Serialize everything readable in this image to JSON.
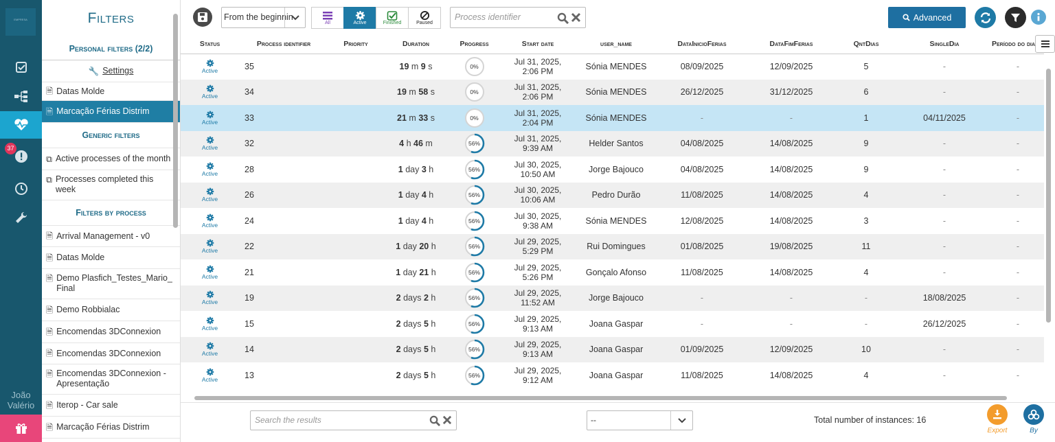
{
  "rail": {
    "logo_text": "EMPRESA",
    "badge": "37",
    "user": "João Valério"
  },
  "filters": {
    "title": "Filters",
    "personal_header": "Personal filters (2/2)",
    "settings_label": "Settings",
    "personal_items": [
      "Datas Molde",
      "Marcação Férias Distrim"
    ],
    "generic_header": "Generic filters",
    "generic_items": [
      "Active processes of the month",
      "Processes completed this week"
    ],
    "byprocess_header": "Filters by process",
    "process_items": [
      "Arrival Management - v0",
      "Datas Molde",
      "Demo Plasfich_Testes_Mario_Final",
      "Demo Robbialac",
      "Encomendas 3DConnexion",
      "Encomendas 3DConnexion",
      "Encomendas 3DConnexion - Apresentação",
      "Iterop - Car sale",
      "Marcação Férias Distrim"
    ]
  },
  "toolbar": {
    "date_filter": "From the beginnin",
    "segments": [
      {
        "label": "All",
        "icon": "list-icon"
      },
      {
        "label": "Active",
        "icon": "gear-icon"
      },
      {
        "label": "Finished",
        "icon": "check-icon"
      },
      {
        "label": "Paused",
        "icon": "ban-icon"
      }
    ],
    "process_placeholder": "Process identifier",
    "advanced_label": "Advanced"
  },
  "columns": [
    "Status",
    "Process identifier",
    "Priority",
    "Duration",
    "Progress",
    "Start date",
    "user_name",
    "DataInicioFerias",
    "DataFimFerias",
    "QntDias",
    "SingleDia",
    "Período do dia"
  ],
  "rows": [
    {
      "status": "Active",
      "id": "35",
      "priority": "",
      "dur": [
        [
          "19",
          "m"
        ],
        [
          "9",
          "s"
        ]
      ],
      "progress": 0,
      "pct": "0%",
      "start1": "Jul 31, 2025,",
      "start2": "2:06 PM",
      "user": "Sónia MENDES",
      "inicio": "08/09/2025",
      "fim": "12/09/2025",
      "qnt": "5",
      "single": "-",
      "periodo": "-"
    },
    {
      "status": "Active",
      "id": "34",
      "priority": "",
      "dur": [
        [
          "19",
          "m"
        ],
        [
          "58",
          "s"
        ]
      ],
      "progress": 0,
      "pct": "0%",
      "start1": "Jul 31, 2025,",
      "start2": "2:06 PM",
      "user": "Sónia MENDES",
      "inicio": "26/12/2025",
      "fim": "31/12/2025",
      "qnt": "6",
      "single": "-",
      "periodo": "-"
    },
    {
      "status": "Active",
      "id": "33",
      "priority": "",
      "dur": [
        [
          "21",
          "m"
        ],
        [
          "33",
          "s"
        ]
      ],
      "progress": 0,
      "pct": "0%",
      "start1": "Jul 31, 2025,",
      "start2": "2:04 PM",
      "user": "Sónia MENDES",
      "inicio": "-",
      "fim": "-",
      "qnt": "1",
      "single": "04/11/2025",
      "periodo": "-",
      "selected": true
    },
    {
      "status": "Active",
      "id": "32",
      "priority": "",
      "dur": [
        [
          "4",
          "h"
        ],
        [
          "46",
          "m"
        ]
      ],
      "progress": 0.56,
      "pct": "56%",
      "start1": "Jul 31, 2025,",
      "start2": "9:39 AM",
      "user": "Helder Santos",
      "inicio": "04/08/2025",
      "fim": "14/08/2025",
      "qnt": "9",
      "single": "-",
      "periodo": "-"
    },
    {
      "status": "Active",
      "id": "28",
      "priority": "",
      "dur": [
        [
          "1",
          "day"
        ],
        [
          "3",
          "h"
        ]
      ],
      "progress": 0.56,
      "pct": "56%",
      "start1": "Jul 30, 2025,",
      "start2": "10:50 AM",
      "user": "Jorge Bajouco",
      "inicio": "04/08/2025",
      "fim": "14/08/2025",
      "qnt": "9",
      "single": "-",
      "periodo": "-"
    },
    {
      "status": "Active",
      "id": "26",
      "priority": "",
      "dur": [
        [
          "1",
          "day"
        ],
        [
          "4",
          "h"
        ]
      ],
      "progress": 0.56,
      "pct": "56%",
      "start1": "Jul 30, 2025,",
      "start2": "10:06 AM",
      "user": "Pedro Durão",
      "inicio": "11/08/2025",
      "fim": "14/08/2025",
      "qnt": "4",
      "single": "-",
      "periodo": "-"
    },
    {
      "status": "Active",
      "id": "24",
      "priority": "",
      "dur": [
        [
          "1",
          "day"
        ],
        [
          "4",
          "h"
        ]
      ],
      "progress": 0.56,
      "pct": "56%",
      "start1": "Jul 30, 2025,",
      "start2": "9:38 AM",
      "user": "Sónia MENDES",
      "inicio": "12/08/2025",
      "fim": "14/08/2025",
      "qnt": "3",
      "single": "-",
      "periodo": "-"
    },
    {
      "status": "Active",
      "id": "22",
      "priority": "",
      "dur": [
        [
          "1",
          "day"
        ],
        [
          "20",
          "h"
        ]
      ],
      "progress": 0.56,
      "pct": "56%",
      "start1": "Jul 29, 2025,",
      "start2": "5:29 PM",
      "user": "Rui Domingues",
      "inicio": "01/08/2025",
      "fim": "19/08/2025",
      "qnt": "11",
      "single": "-",
      "periodo": "-"
    },
    {
      "status": "Active",
      "id": "21",
      "priority": "",
      "dur": [
        [
          "1",
          "day"
        ],
        [
          "21",
          "h"
        ]
      ],
      "progress": 0.56,
      "pct": "56%",
      "start1": "Jul 29, 2025,",
      "start2": "5:26 PM",
      "user": "Gonçalo Afonso",
      "inicio": "11/08/2025",
      "fim": "14/08/2025",
      "qnt": "4",
      "single": "-",
      "periodo": "-"
    },
    {
      "status": "Active",
      "id": "19",
      "priority": "",
      "dur": [
        [
          "2",
          "days"
        ],
        [
          "2",
          "h"
        ]
      ],
      "progress": 0.56,
      "pct": "56%",
      "start1": "Jul 29, 2025,",
      "start2": "11:52 AM",
      "user": "Jorge Bajouco",
      "inicio": "-",
      "fim": "-",
      "qnt": "-",
      "single": "18/08/2025",
      "periodo": "-"
    },
    {
      "status": "Active",
      "id": "15",
      "priority": "",
      "dur": [
        [
          "2",
          "days"
        ],
        [
          "5",
          "h"
        ]
      ],
      "progress": 0.56,
      "pct": "56%",
      "start1": "Jul 29, 2025,",
      "start2": "9:13 AM",
      "user": "Joana Gaspar",
      "inicio": "-",
      "fim": "-",
      "qnt": "-",
      "single": "26/12/2025",
      "periodo": "-"
    },
    {
      "status": "Active",
      "id": "14",
      "priority": "",
      "dur": [
        [
          "2",
          "days"
        ],
        [
          "5",
          "h"
        ]
      ],
      "progress": 0.56,
      "pct": "56%",
      "start1": "Jul 29, 2025,",
      "start2": "9:13 AM",
      "user": "Joana Gaspar",
      "inicio": "01/09/2025",
      "fim": "12/09/2025",
      "qnt": "10",
      "single": "-",
      "periodo": "-"
    },
    {
      "status": "Active",
      "id": "13",
      "priority": "",
      "dur": [
        [
          "2",
          "days"
        ],
        [
          "5",
          "h"
        ]
      ],
      "progress": 0.56,
      "pct": "56%",
      "start1": "Jul 29, 2025,",
      "start2": "9:12 AM",
      "user": "Joana Gaspar",
      "inicio": "11/08/2025",
      "fim": "14/08/2025",
      "qnt": "4",
      "single": "-",
      "periodo": "-"
    }
  ],
  "footer": {
    "search_placeholder": "Search the results",
    "page_select": "--",
    "total": "Total number of instances: 16",
    "export_label": "Export",
    "by_label": "By"
  },
  "colors": {
    "accent": "#1e7aa6",
    "rail": "#18576d",
    "export": "#f39c2c",
    "gift": "#e8467a"
  }
}
